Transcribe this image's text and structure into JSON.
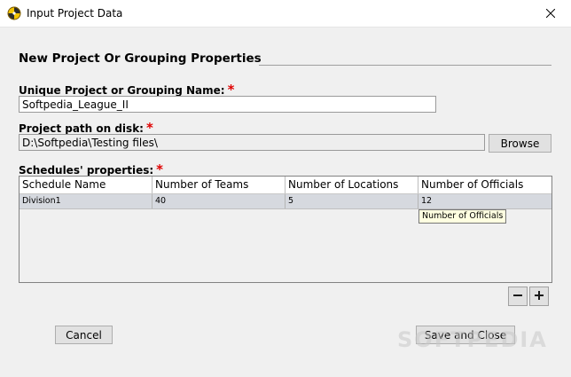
{
  "window": {
    "title": "Input Project Data",
    "app_icon": "pinwheel-icon",
    "close_icon": "close-icon"
  },
  "form": {
    "section_header": "New Project Or Grouping Properties",
    "required_mark": "*",
    "name_label": "Unique Project or Grouping Name:",
    "name_value": "Softpedia_League_II",
    "path_label": "Project path on disk:",
    "path_value": "D:\\Softpedia\\Testing files\\",
    "browse_label": "Browse",
    "schedules_label": "Schedules' properties:"
  },
  "table": {
    "columns": [
      "Schedule Name",
      "Number of Teams",
      "Number of Locations",
      "Number of Officials"
    ],
    "rows": [
      [
        "Division1",
        "40",
        "5",
        "12"
      ]
    ]
  },
  "tooltip": {
    "text": "Number of Officials"
  },
  "row_buttons": {
    "remove_icon": "minus-icon",
    "add_icon": "plus-icon"
  },
  "footer": {
    "cancel_label": "Cancel",
    "save_label": "Save and Close"
  },
  "watermark": {
    "text": "SOFTPEDIA"
  },
  "colors": {
    "required": "#e00000",
    "selected_row": "#d6d9df",
    "tooltip_bg": "#ffffe1"
  }
}
